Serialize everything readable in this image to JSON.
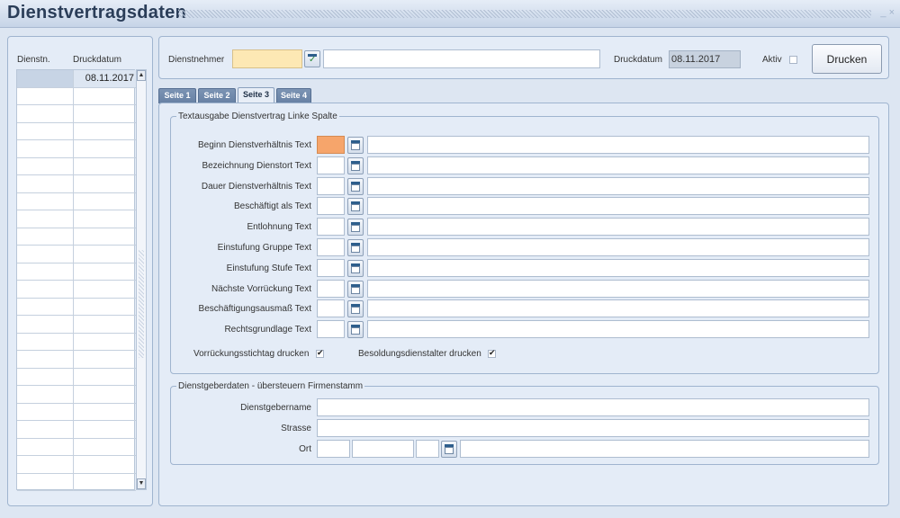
{
  "window": {
    "title": "Dienstvertragsdaten",
    "controls": "_ ×"
  },
  "list": {
    "headers": {
      "nr": "Dienstn.",
      "datum": "Druckdatum"
    },
    "rows": [
      {
        "nr": "",
        "datum": "08.11.2017",
        "selected": true
      }
    ],
    "empty_rows": 23
  },
  "top": {
    "dienstnehmer_label": "Dienstnehmer",
    "dienstnehmer_code": "",
    "dienstnehmer_name": "",
    "druckdatum_label": "Druckdatum",
    "druckdatum_value": "08.11.2017",
    "aktiv_label": "Aktiv",
    "aktiv_checked": false,
    "print_button": "Drucken"
  },
  "tabs": [
    {
      "label": "Seite 1",
      "active": false
    },
    {
      "label": "Seite 2",
      "active": false
    },
    {
      "label": "Seite 3",
      "active": true
    },
    {
      "label": "Seite 4",
      "active": false
    }
  ],
  "group_text": {
    "legend": "Textausgabe Dienstvertrag Linke Spalte",
    "rows": [
      {
        "label": "Beginn Dienstverhältnis Text",
        "code": "",
        "text": ""
      },
      {
        "label": "Bezeichnung Dienstort Text",
        "code": "",
        "text": ""
      },
      {
        "label": "Dauer Dienstverhältnis Text",
        "code": "",
        "text": ""
      },
      {
        "label": "Beschäftigt als Text",
        "code": "",
        "text": ""
      },
      {
        "label": "Entlohnung Text",
        "code": "",
        "text": ""
      },
      {
        "label": "Einstufung Gruppe Text",
        "code": "",
        "text": ""
      },
      {
        "label": "Einstufung Stufe Text",
        "code": "",
        "text": ""
      },
      {
        "label": "Nächste Vorrückung Text",
        "code": "",
        "text": ""
      },
      {
        "label": "Beschäftigungsausmaß Text",
        "code": "",
        "text": ""
      },
      {
        "label": "Rechtsgrundlage Text",
        "code": "",
        "text": ""
      }
    ],
    "check_vorrueckung_label": "Vorrückungsstichtag drucken",
    "check_vorrueckung_checked": true,
    "check_besoldung_label": "Besoldungsdienstalter drucken",
    "check_besoldung_checked": true
  },
  "group_dg": {
    "legend": "Dienstgeberdaten - übersteuern Firmenstamm",
    "name_label": "Dienstgebername",
    "name_value": "",
    "strasse_label": "Strasse",
    "strasse_value": "",
    "ort_label": "Ort",
    "ort_values": [
      "",
      "",
      "",
      ""
    ]
  },
  "colors": {
    "focus_field": "#f6a56b",
    "tab_inactive": "#6f88ab",
    "panel": "#e4ecf7"
  }
}
